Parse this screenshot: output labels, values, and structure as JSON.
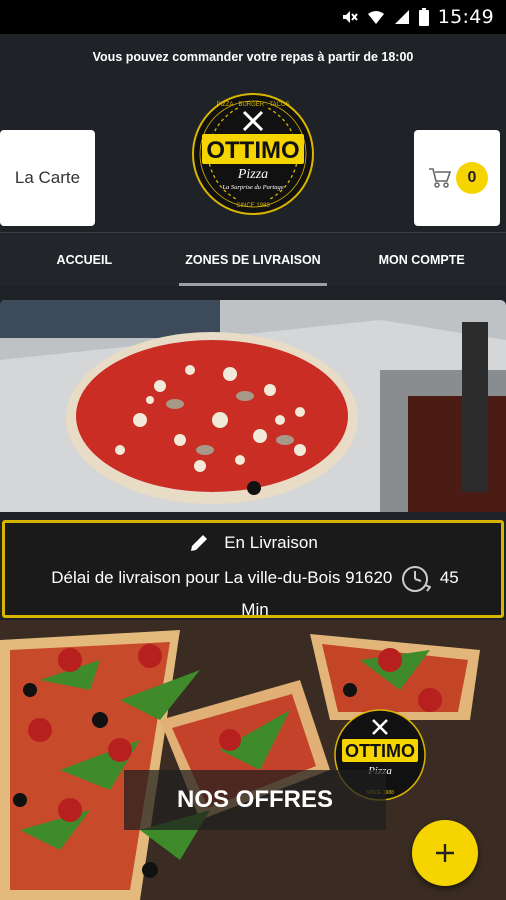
{
  "status_bar": {
    "time": "15:49",
    "icons": [
      "mute-icon",
      "wifi-icon",
      "signal-icon",
      "battery-icon"
    ]
  },
  "header": {
    "notice": "Vous pouvez commander votre repas à partir de 18:00",
    "menu_button": "La Carte",
    "cart_count": "0",
    "logo": {
      "name": "OTTIMO",
      "sub": "Pizza",
      "ring_top": "PIZZA · BURGER · TACOS",
      "tagline": "La Surprise du Partage",
      "since": "SINCE 1988"
    }
  },
  "tabs": [
    {
      "label": "ACCUEIL"
    },
    {
      "label": "ZONES DE LIVRAISON"
    },
    {
      "label": "MON COMPTE"
    }
  ],
  "delivery": {
    "title": "En Livraison",
    "line": "Délai de livraison pour La ville-du-Bois 91620",
    "time_value": "45",
    "time_unit": "Min"
  },
  "offers": {
    "label": "NOS OFFRES"
  },
  "colors": {
    "accent": "#f5d400",
    "header_bg": "#1f2327",
    "delivery_border": "#d8b400"
  }
}
